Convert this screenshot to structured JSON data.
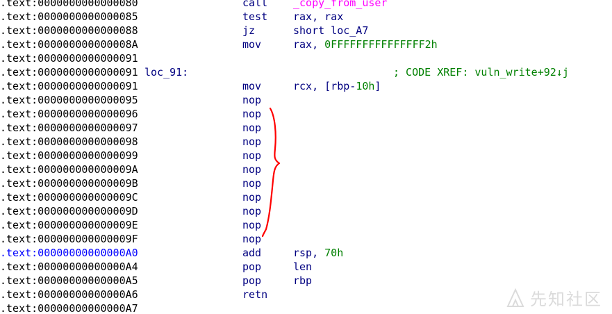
{
  "disassembly": {
    "rows": [
      {
        "addr": ".text:0000000000000080",
        "mnem": "call",
        "op_func": "_copy_from_user",
        "addr_color": "normal"
      },
      {
        "addr": ".text:0000000000000085",
        "mnem": "test",
        "op_text": "rax, rax"
      },
      {
        "addr": ".text:0000000000000088",
        "mnem": "jz",
        "op_text": "short loc_A7"
      },
      {
        "addr": ".text:000000000000008A",
        "mnem": "mov",
        "op_text": "rax, ",
        "op_num": "0FFFFFFFFFFFFFFF2h"
      },
      {
        "addr": ".text:0000000000000091"
      },
      {
        "addr": ".text:0000000000000091",
        "label": "loc_91:",
        "comment": "; CODE XREF: vuln_write+92↓j"
      },
      {
        "addr": ".text:0000000000000091",
        "mnem": "mov",
        "op_text": "rcx, [rbp-",
        "op_num": "10h",
        "op_after": "]"
      },
      {
        "addr": ".text:0000000000000095",
        "mnem": "nop"
      },
      {
        "addr": ".text:0000000000000096",
        "mnem": "nop"
      },
      {
        "addr": ".text:0000000000000097",
        "mnem": "nop"
      },
      {
        "addr": ".text:0000000000000098",
        "mnem": "nop"
      },
      {
        "addr": ".text:0000000000000099",
        "mnem": "nop"
      },
      {
        "addr": ".text:000000000000009A",
        "mnem": "nop"
      },
      {
        "addr": ".text:000000000000009B",
        "mnem": "nop"
      },
      {
        "addr": ".text:000000000000009C",
        "mnem": "nop"
      },
      {
        "addr": ".text:000000000000009D",
        "mnem": "nop"
      },
      {
        "addr": ".text:000000000000009E",
        "mnem": "nop"
      },
      {
        "addr": ".text:000000000000009F",
        "mnem": "nop"
      },
      {
        "addr": ".text:00000000000000A0",
        "mnem": "add",
        "op_text": "rsp, ",
        "op_num": "70h",
        "highlight": true
      },
      {
        "addr": ".text:00000000000000A4",
        "mnem": "pop",
        "op_text": "len"
      },
      {
        "addr": ".text:00000000000000A5",
        "mnem": "pop",
        "op_text": "rbp"
      },
      {
        "addr": ".text:00000000000000A6",
        "mnem": "retn"
      },
      {
        "addr": ".text:00000000000000A7"
      }
    ]
  },
  "watermark": {
    "text": "先知社区",
    "icon": "xianzhi-logo-icon"
  },
  "colors": {
    "mnemonic": "#000080",
    "number": "#008000",
    "function": "#ff00ff",
    "comment": "#008000",
    "highlight_address": "#0000ff",
    "annotation": "#ff0000"
  }
}
